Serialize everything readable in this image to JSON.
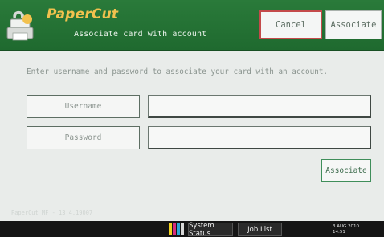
{
  "header": {
    "brand": "PaperCut",
    "subtitle": "Associate card with account",
    "cancel_label": "Cancel",
    "associate_label": "Associate",
    "logo_icon": "papercut-printer-logo-icon"
  },
  "main": {
    "instructions": "Enter username and password to associate your card with an account.",
    "username_label": "Username",
    "username_value": "",
    "password_label": "Password",
    "password_value": "",
    "associate_label": "Associate"
  },
  "footer": {
    "version": "PaperCut MF - 13.4.19007"
  },
  "taskbar": {
    "system_status": "System Status",
    "job_list": "Job List",
    "date": "3 AUG 2010",
    "time": "14:51",
    "color_indicator": "ymck-toner-icon"
  },
  "colors": {
    "header_green": "#2a7a3a",
    "brand_yellow": "#f2c14e",
    "cancel_border": "#c44a4a",
    "button_green_border": "#3f8e5a"
  }
}
